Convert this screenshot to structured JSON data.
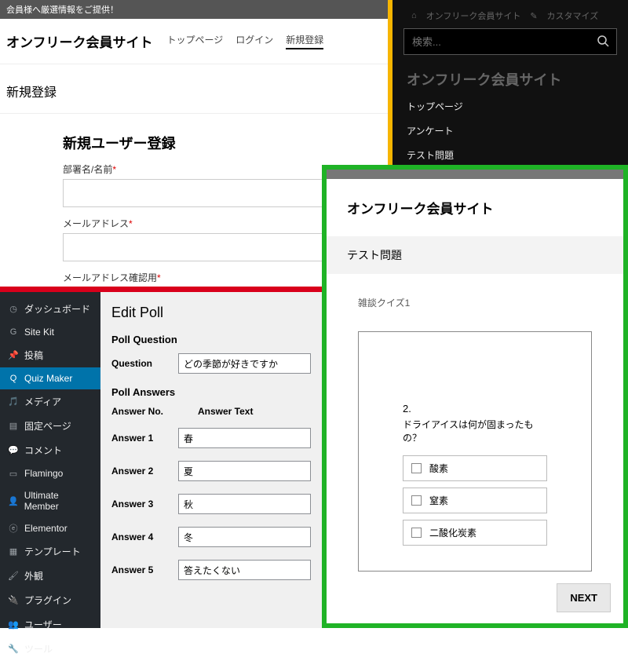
{
  "panel1": {
    "banner": "会員様へ厳選情報をご提供！",
    "site_title": "オンフリーク会員サイト",
    "nav": {
      "top": "トップページ",
      "login": "ログイン",
      "register": "新規登録"
    },
    "page_heading": "新規登録",
    "form_title": "新規ユーザー登録",
    "label_name": "部署名/名前",
    "label_email": "メールアドレス",
    "label_email_confirm": "メールアドレス確認用",
    "required_mark": "*"
  },
  "panel2": {
    "admin_links": {
      "site": "オンフリーク会員サイト",
      "customize": "カスタマイズ"
    },
    "search_placeholder": "検索...",
    "ghost_title": "オンフリーク会員サイト",
    "links": [
      "トップページ",
      "アンケート",
      "テスト問題"
    ]
  },
  "panel3": {
    "sidebar": [
      {
        "icon": "dashboard-icon",
        "label": "ダッシュボード"
      },
      {
        "icon": "google-icon",
        "label": "Site Kit"
      },
      {
        "icon": "pin-icon",
        "label": "投稿"
      },
      {
        "icon": "quiz-icon",
        "label": "Quiz Maker",
        "active": true
      },
      {
        "icon": "media-icon",
        "label": "メディア"
      },
      {
        "icon": "page-icon",
        "label": "固定ページ"
      },
      {
        "icon": "comment-icon",
        "label": "コメント"
      },
      {
        "icon": "flamingo-icon",
        "label": "Flamingo"
      },
      {
        "icon": "user-icon",
        "label": "Ultimate Member"
      },
      {
        "icon": "elementor-icon",
        "label": "Elementor"
      },
      {
        "icon": "template-icon",
        "label": "テンプレート"
      },
      {
        "icon": "brush-icon",
        "label": "外観"
      },
      {
        "icon": "plugin-icon",
        "label": "プラグイン"
      },
      {
        "icon": "users-icon",
        "label": "ユーザー"
      },
      {
        "icon": "wrench-icon",
        "label": "ツール"
      }
    ],
    "heading": "Edit Poll",
    "section_q": "Poll Question",
    "question_label": "Question",
    "question_value": "どの季節が好きですか",
    "section_a": "Poll Answers",
    "col_no": "Answer No.",
    "col_text": "Answer Text",
    "answers": [
      {
        "label": "Answer 1",
        "value": "春"
      },
      {
        "label": "Answer 2",
        "value": "夏"
      },
      {
        "label": "Answer 3",
        "value": "秋"
      },
      {
        "label": "Answer 4",
        "value": "冬"
      },
      {
        "label": "Answer 5",
        "value": "答えたくない"
      }
    ]
  },
  "panel4": {
    "site_title": "オンフリーク会員サイト",
    "page_title": "テスト問題",
    "quiz_name": "雑談クイズ1",
    "q_number": "2.",
    "q_text": "ドライアイスは何が固まったもの？",
    "options": [
      "酸素",
      "窒素",
      "二酸化炭素"
    ],
    "next_label": "NEXT"
  }
}
